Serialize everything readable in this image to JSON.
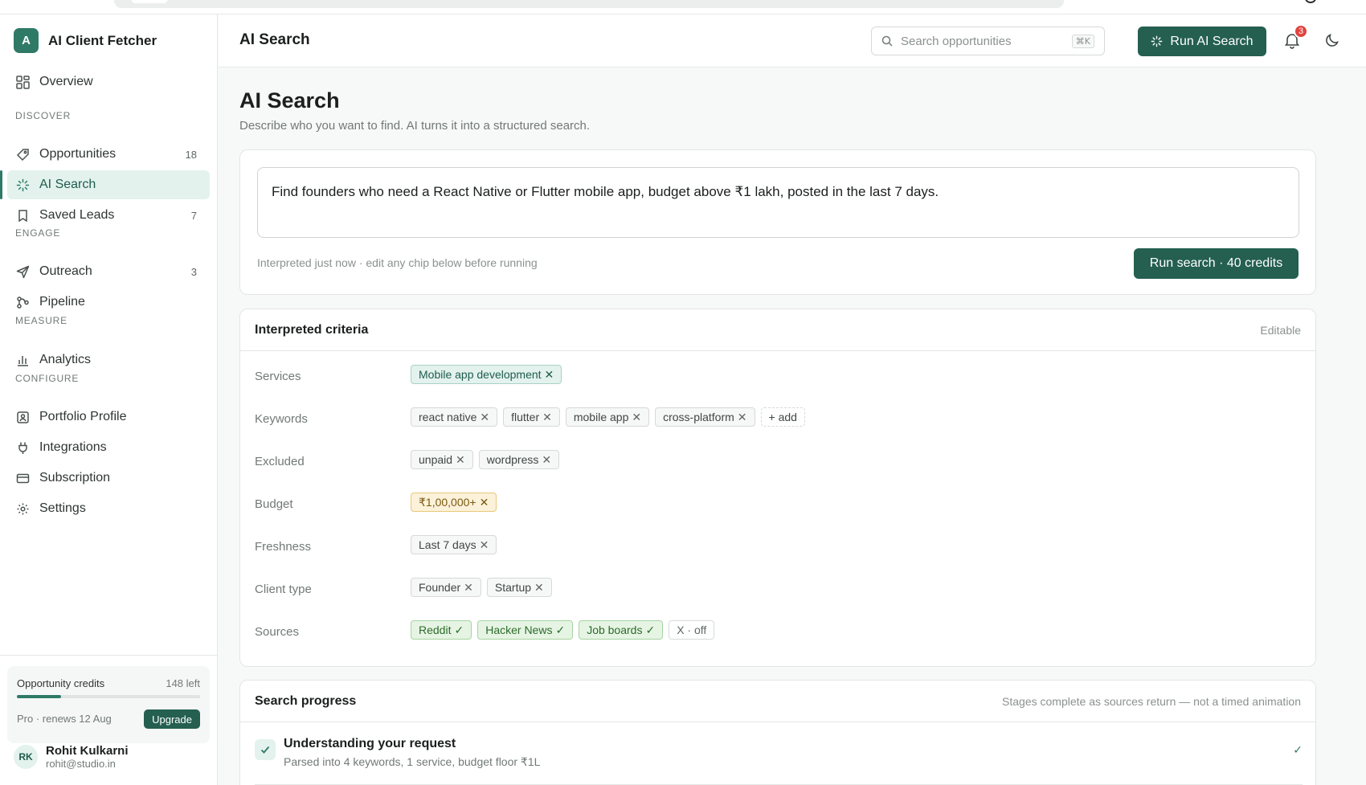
{
  "app": {
    "brand_initial": "A",
    "brand_name": "AI Client Fetcher"
  },
  "sidebar": {
    "overview": "Overview",
    "sections": {
      "discover": "DISCOVER",
      "engage": "ENGAGE",
      "measure": "MEASURE",
      "configure": "CONFIGURE"
    },
    "items": {
      "opportunities": {
        "label": "Opportunities",
        "count": "18"
      },
      "ai_search": {
        "label": "AI Search"
      },
      "saved_leads": {
        "label": "Saved Leads",
        "count": "7"
      },
      "outreach": {
        "label": "Outreach",
        "count": "3"
      },
      "pipeline": {
        "label": "Pipeline"
      },
      "analytics": {
        "label": "Analytics"
      },
      "portfolio": {
        "label": "Portfolio Profile"
      },
      "integrations": {
        "label": "Integrations"
      },
      "subscription": {
        "label": "Subscription"
      },
      "settings": {
        "label": "Settings"
      }
    },
    "credits": {
      "title": "Opportunity credits",
      "left": "148 left",
      "fill_fraction": 0.24,
      "renew": "Pro · renews 12 Aug",
      "upgrade": "Upgrade"
    },
    "user": {
      "initials": "RK",
      "name": "Rohit Kulkarni",
      "email": "rohit@studio.in"
    }
  },
  "header": {
    "title": "AI Search",
    "search_placeholder": "Search opportunities",
    "shortcut": "⌘K",
    "run_button": "Run AI Search",
    "notification_count": "3"
  },
  "main": {
    "title": "AI Search",
    "subtitle": "Describe who you want to find. AI turns it into a structured search.",
    "query": "Find founders who need a React Native or Flutter mobile app, budget above ₹1 lakh, posted in the last 7 days.",
    "hint": "Interpreted just now · edit any chip below before running",
    "run_search": "Run search · 40 credits"
  },
  "criteria": {
    "title": "Interpreted criteria",
    "editable": "Editable",
    "rows": {
      "services": {
        "label": "Services",
        "chips": [
          "Mobile app development"
        ]
      },
      "keywords": {
        "label": "Keywords",
        "chips": [
          "react native",
          "flutter",
          "mobile app",
          "cross-platform"
        ],
        "add": "+ add"
      },
      "excluded": {
        "label": "Excluded",
        "chips": [
          "unpaid",
          "wordpress"
        ]
      },
      "budget": {
        "label": "Budget",
        "chips": [
          "₹1,00,000+"
        ]
      },
      "freshness": {
        "label": "Freshness",
        "chips": [
          "Last 7 days"
        ]
      },
      "client_type": {
        "label": "Client type",
        "chips": [
          "Founder",
          "Startup"
        ]
      },
      "sources": {
        "label": "Sources",
        "chips": [
          "Reddit",
          "Hacker News",
          "Job boards"
        ],
        "off": "X · off"
      }
    }
  },
  "progress": {
    "title": "Search progress",
    "note": "Stages complete as sources return — not a timed animation",
    "stages": [
      {
        "title": "Understanding your request",
        "desc": "Parsed into 4 keywords, 1 service, budget floor ₹1L",
        "status": "✓"
      }
    ]
  },
  "colors": {
    "accent": "#245f50",
    "accent_light": "#e3f2ed",
    "badge_red": "#e0443e"
  }
}
